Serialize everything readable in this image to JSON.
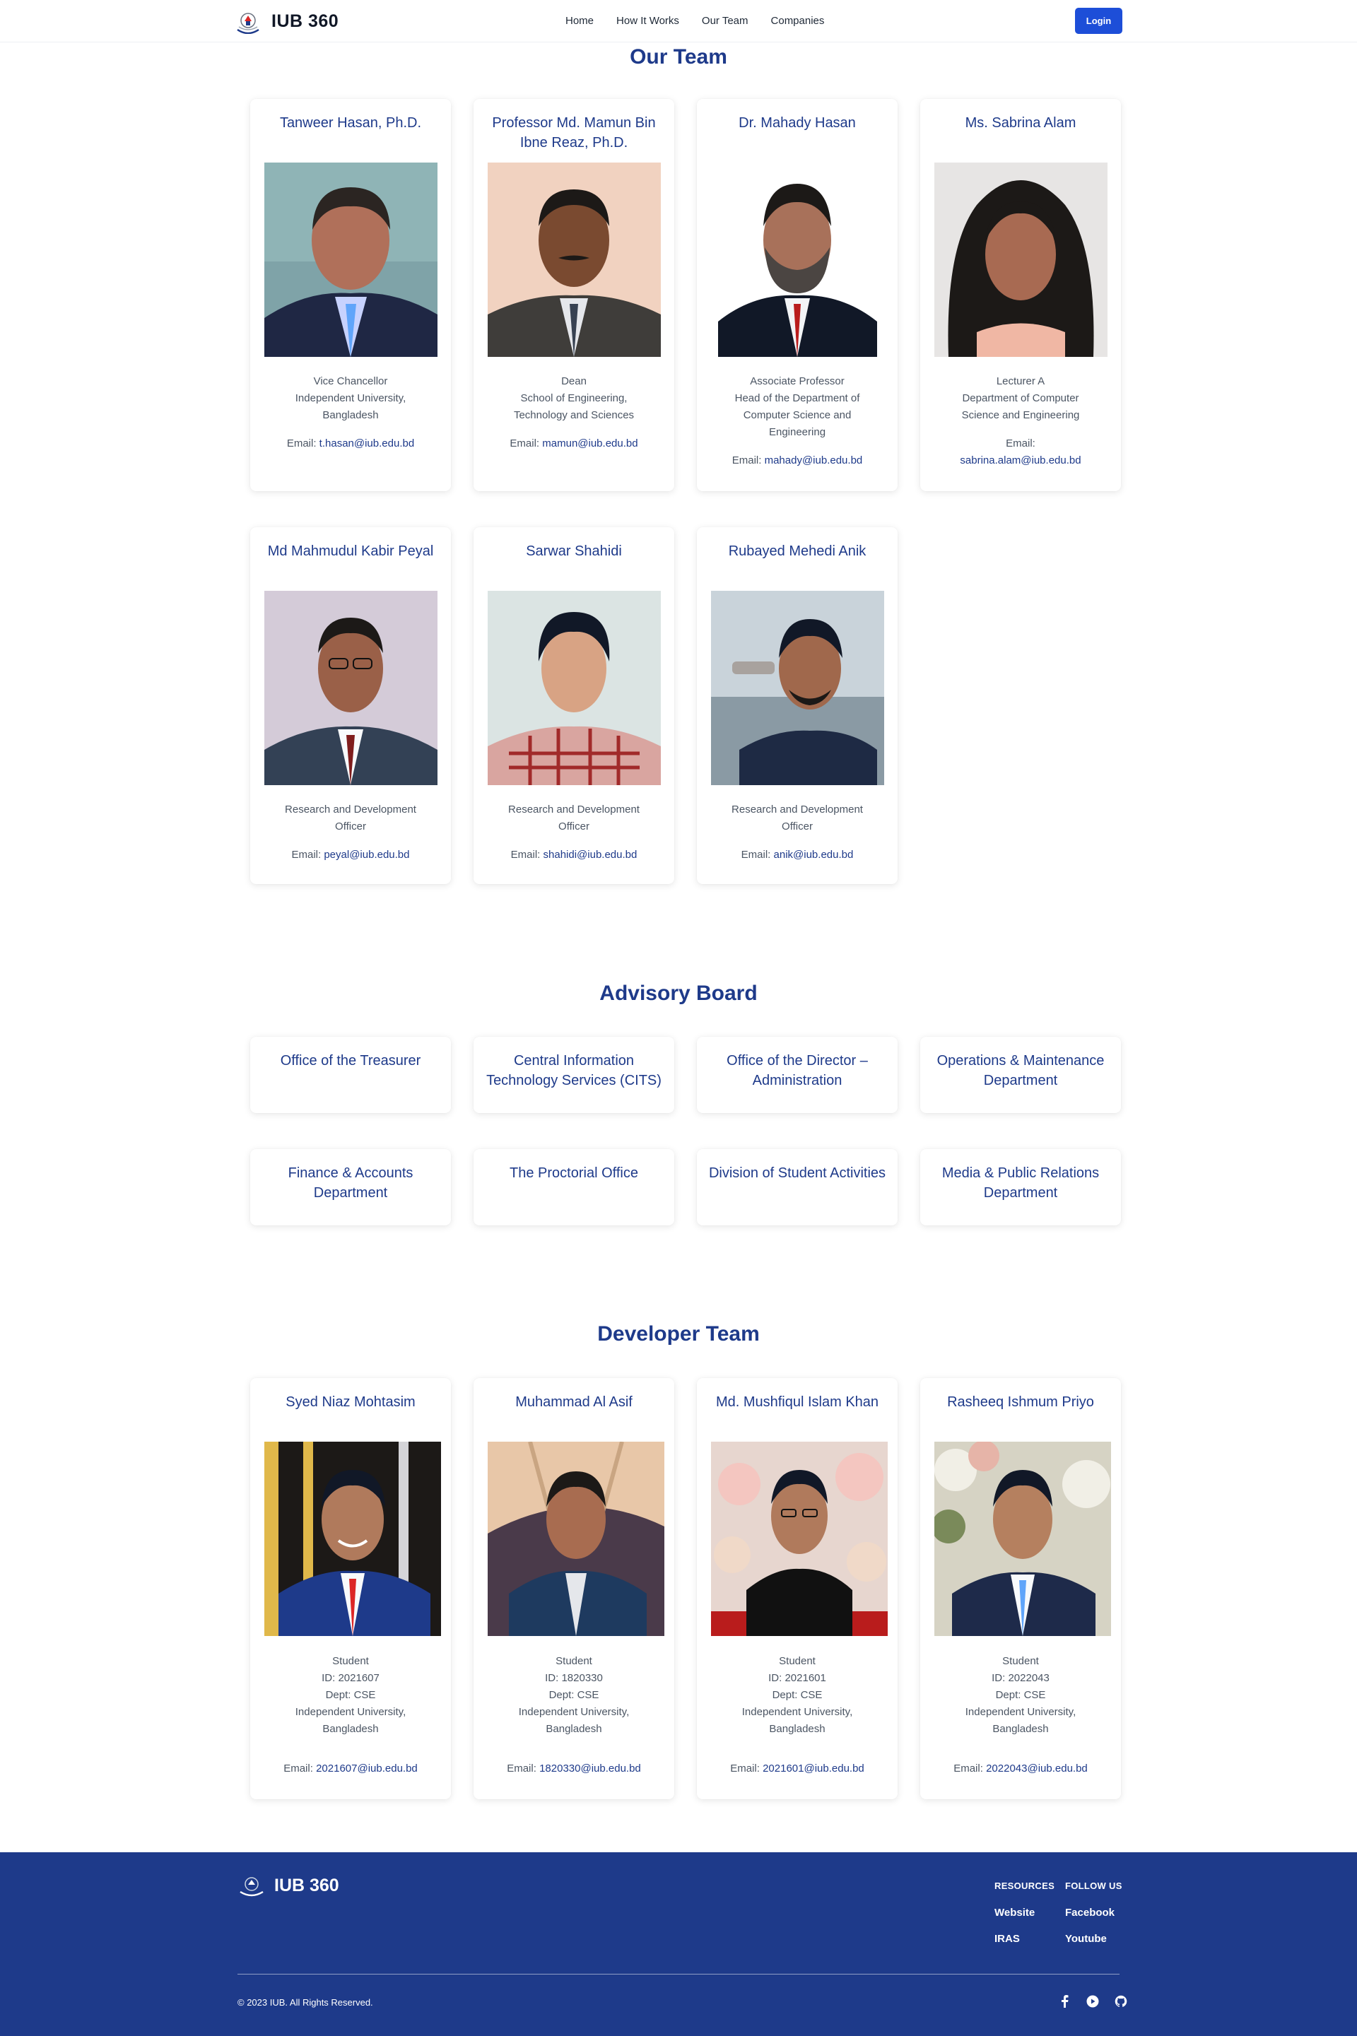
{
  "nav": {
    "brand": "IUB 360",
    "links": [
      "Home",
      "How It Works",
      "Our Team",
      "Companies"
    ],
    "login": "Login"
  },
  "team": {
    "title": "Our Team",
    "members": [
      {
        "name": "Tanweer Hasan, Ph.D.",
        "role": [
          "Vice Chancellor",
          "Independent University,",
          "Bangladesh"
        ],
        "email_label": "Email:",
        "email": "t.hasan@iub.edu.bd"
      },
      {
        "name": "Professor Md. Mamun Bin Ibne Reaz, Ph.D.",
        "role": [
          "Dean",
          "School of Engineering,",
          "Technology and Sciences"
        ],
        "email_label": "Email:",
        "email": "mamun@iub.edu.bd"
      },
      {
        "name": "Dr. Mahady Hasan",
        "role": [
          "Associate Professor",
          "Head of the Department of",
          "Computer Science and",
          "Engineering"
        ],
        "email_label": "Email:",
        "email": "mahady@iub.edu.bd"
      },
      {
        "name": "Ms. Sabrina Alam",
        "role": [
          "Lecturer A",
          "Department of Computer",
          "Science and Engineering"
        ],
        "email_label": "Email:",
        "email": "sabrina.alam@iub.edu.bd"
      },
      {
        "name": "Md Mahmudul Kabir Peyal",
        "role": [
          "Research and Development",
          "Officer"
        ],
        "email_label": "Email:",
        "email": "peyal@iub.edu.bd"
      },
      {
        "name": "Sarwar Shahidi",
        "role": [
          "Research and Development",
          "Officer"
        ],
        "email_label": "Email:",
        "email": "shahidi@iub.edu.bd"
      },
      {
        "name": "Rubayed Mehedi Anik",
        "role": [
          "Research and Development",
          "Officer"
        ],
        "email_label": "Email:",
        "email": "anik@iub.edu.bd"
      }
    ]
  },
  "advisory": {
    "title": "Advisory Board",
    "items": [
      "Office of the Treasurer",
      "Central Information Technology Services (CITS)",
      "Office of the Director – Administration",
      "Operations & Maintenance Department",
      "Finance & Accounts Department",
      "The Proctorial Office",
      "Division of Student Activities",
      "Media & Public Relations Department"
    ]
  },
  "developers": {
    "title": "Developer Team",
    "members": [
      {
        "name": "Syed Niaz Mohtasim",
        "role": [
          "Student",
          "ID: 2021607",
          "Dept: CSE",
          "Independent University,",
          "Bangladesh"
        ],
        "email_label": "Email:",
        "email": "2021607@iub.edu.bd"
      },
      {
        "name": "Muhammad Al Asif",
        "role": [
          "Student",
          "ID: 1820330",
          "Dept: CSE",
          "Independent University,",
          "Bangladesh"
        ],
        "email_label": "Email:",
        "email": "1820330@iub.edu.bd"
      },
      {
        "name": "Md. Mushfiqul Islam Khan",
        "role": [
          "Student",
          "ID: 2021601",
          "Dept: CSE",
          "Independent University,",
          "Bangladesh"
        ],
        "email_label": "Email:",
        "email": "2021601@iub.edu.bd"
      },
      {
        "name": "Rasheeq Ishmum Priyo",
        "role": [
          "Student",
          "ID: 2022043",
          "Dept: CSE",
          "Independent University,",
          "Bangladesh"
        ],
        "email_label": "Email:",
        "email": "2022043@iub.edu.bd"
      }
    ]
  },
  "footer": {
    "brand": "IUB 360",
    "resources_head": "RESOURCES",
    "resources": [
      "Website",
      "IRAS"
    ],
    "follow_head": "FOLLOW US",
    "follow": [
      "Facebook",
      "Youtube"
    ],
    "copyright": "© 2023 IUB. All Rights Reserved.",
    "social_icons": [
      "facebook-icon",
      "youtube-icon",
      "github-icon"
    ]
  },
  "colors": {
    "accent": "#1e3a8a",
    "button": "#1d4ed8"
  }
}
